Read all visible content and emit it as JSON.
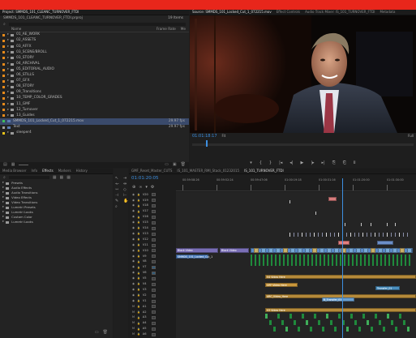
{
  "project": {
    "tab_label": "Project: SMMDS_101_CLEANC_TURNOVER_FTDI",
    "subtitle": "SMMDS_101_CLEANC_TURNOVER_FTDI.prproj",
    "item_count": "19 Items",
    "col_name": "Name",
    "col_fps": "Frame Rate",
    "col_media": "Me",
    "items": [
      {
        "label": "01_AE_WORK",
        "color": "#e88a1a",
        "type": "folder"
      },
      {
        "label": "02_ASSETS",
        "color": "#e88a1a",
        "type": "folder"
      },
      {
        "label": "03_AFFX",
        "color": "#e88a1a",
        "type": "folder"
      },
      {
        "label": "03_SCENE/BROLL",
        "color": "#e88a1a",
        "type": "folder"
      },
      {
        "label": "03_STORY",
        "color": "#e88a1a",
        "type": "folder"
      },
      {
        "label": "04_ARCHIVAL",
        "color": "#e88a1a",
        "type": "folder"
      },
      {
        "label": "05_EDITORIAL_AUDIO",
        "color": "#e88a1a",
        "type": "folder"
      },
      {
        "label": "06_STILLS",
        "color": "#e88a1a",
        "type": "folder"
      },
      {
        "label": "07_GFX",
        "color": "#e88a1a",
        "type": "folder"
      },
      {
        "label": "08_STORY",
        "color": "#e88a1a",
        "type": "folder"
      },
      {
        "label": "09_Transitions",
        "color": "#e88a1a",
        "type": "folder"
      },
      {
        "label": "10_TEMP_COLOR_GRADES",
        "color": "#e88a1a",
        "type": "folder"
      },
      {
        "label": "11_GMF",
        "color": "#e88a1a",
        "type": "folder"
      },
      {
        "label": "12_Turnover",
        "color": "#e88a1a",
        "type": "folder"
      },
      {
        "label": "13_Guides",
        "color": "#e88a1a",
        "type": "folder"
      },
      {
        "label": "SMMDS_101_Locked_Cut_1_072215.mov",
        "color": "#3fbf5a",
        "type": "clip",
        "fps": "29.97 fps"
      },
      {
        "label": "Text",
        "color": "#a0a0a0",
        "type": "clip",
        "fps": "29.97 fps"
      },
      {
        "label": "sleeper4",
        "color": "#e8c21a",
        "type": "folder"
      }
    ]
  },
  "source": {
    "tabs": [
      "Source: SMMDS_101_Locked_Cut_1_072215.mov",
      "Effect Controls",
      "Audio Track Mixer: IS_101_TURNOVER_FTDI",
      "Metadata"
    ],
    "timecode": "01:01:18:17",
    "fit": "Fit",
    "ratio": "Full"
  },
  "effects": {
    "tabs": [
      "Media Browser",
      "Info",
      "Effects",
      "Markers",
      "History"
    ],
    "items": [
      "Presets",
      "Audio Effects",
      "Audio Transitions",
      "Video Effects",
      "Video Transitions",
      "Lumetri Presets",
      "Lumetri Looks",
      "Custom Color",
      "Lumetri Looks"
    ]
  },
  "timeline": {
    "tabs": [
      "GMF_Reset_Master_CUTS",
      "IS_101_MASTER_RMI_Stack_01232015",
      "IS_101_TURNOVER_FTDI"
    ],
    "timecode": "01:01:20:05",
    "ruler": [
      "00:59:58:26",
      "00:59:52:24",
      "00:59:47:06",
      "01:00:19:18",
      "01:00:31:16",
      "01:01:20:00",
      "01:01:30:00"
    ],
    "tracks": [
      "V20",
      "V19",
      "V18",
      "V17",
      "V16",
      "V15",
      "V14",
      "V13",
      "V12",
      "V11",
      "V10",
      "V9",
      "V8",
      "V7",
      "V6",
      "V5",
      "V4",
      "V3",
      "V2",
      "V1",
      "A1",
      "A2",
      "A3",
      "A4",
      "A5",
      "A6"
    ],
    "clip_labels": [
      "Black Video",
      "Black Video",
      "SMMDS_101_Locked_Cut_1",
      "V4 Video Here",
      "OFF Video Here",
      "Transfer_01",
      "ARC_Video_Here",
      "B_Transfer_01",
      "V3 Video Here"
    ]
  }
}
